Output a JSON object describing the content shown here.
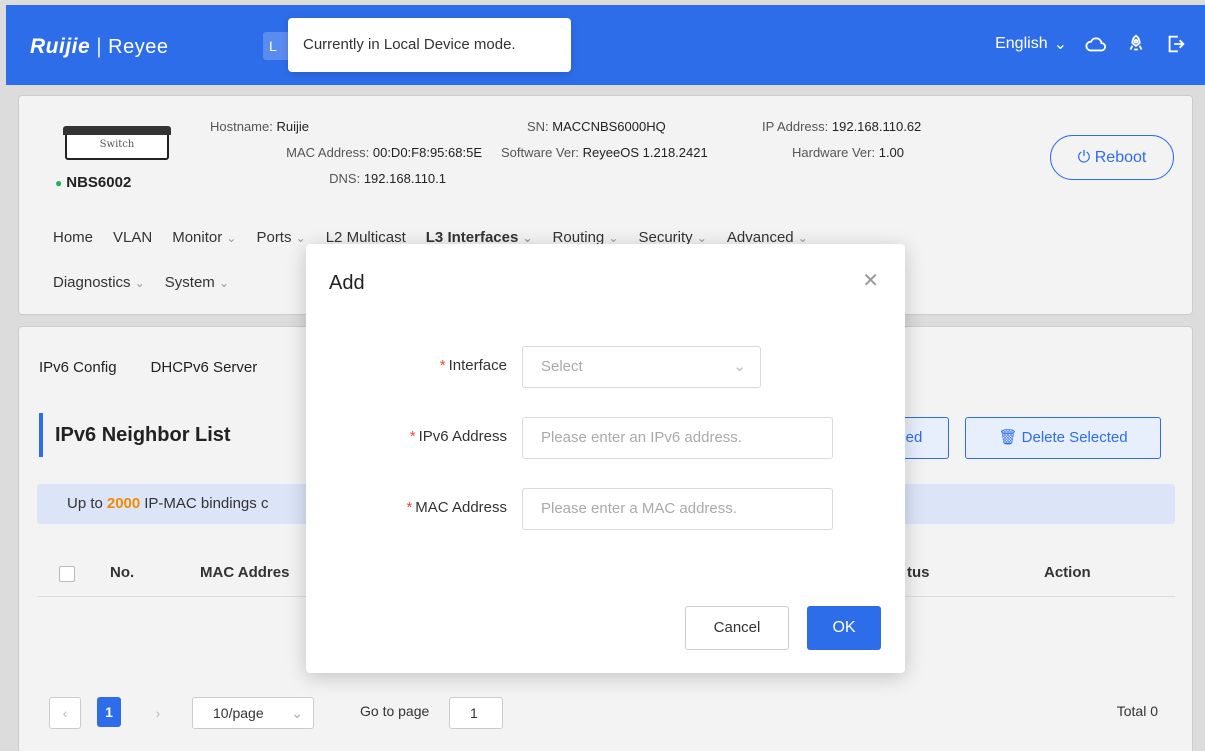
{
  "brand": {
    "logo": "Ruijie",
    "logo2": "Reyee",
    "mode_button_stub": "L"
  },
  "tooltip": "Currently in Local Device mode.",
  "topbar": {
    "language": "English"
  },
  "device": {
    "image_label": "Switch",
    "model": "NBS6002",
    "hostname_label": "Hostname:",
    "hostname": "Ruijie",
    "mac_label": "MAC Address:",
    "mac": "00:D0:F8:95:68:5E",
    "dns_label": "DNS:",
    "dns": "192.168.110.1",
    "sn_label": "SN:",
    "sn": "MACCNBS6000HQ",
    "software_label": "Software Ver:",
    "software": "ReyeeOS 1.218.2421",
    "ip_label": "IP Address:",
    "ip": "192.168.110.62",
    "hardware_label": "Hardware Ver:",
    "hardware": "1.00",
    "reboot_label": "Reboot"
  },
  "menu": {
    "row1": [
      "Home",
      "VLAN",
      "Monitor",
      "Ports",
      "L2 Multicast",
      "L3 Interfaces",
      "Routing",
      "Security",
      "Advanced"
    ],
    "row2": [
      "Diagnostics",
      "System"
    ]
  },
  "content": {
    "tabs": [
      "IPv6 Config",
      "DHCPv6 Server"
    ],
    "section_title": "IPv6 Neighbor List",
    "bind_selected_stub": "ed",
    "delete_selected": "Delete Selected",
    "notice_prefix": "Up to",
    "notice_count": "2000",
    "notice_suffix": "IP-MAC bindings c",
    "columns": {
      "no": "No.",
      "mac": "MAC Addres",
      "status": "tus",
      "action": "Action"
    },
    "pager": {
      "current": "1",
      "page_size": "10/page",
      "goto_label": "Go to page",
      "goto_value": "1",
      "total": "Total 0"
    }
  },
  "dialog": {
    "title": "Add",
    "interface_label": "Interface",
    "interface_placeholder": "Select",
    "ipv6_label": "IPv6 Address",
    "ipv6_placeholder": "Please enter an IPv6 address.",
    "mac_label": "MAC Address",
    "mac_placeholder": "Please enter a MAC address.",
    "cancel": "Cancel",
    "ok": "OK"
  },
  "colors": {
    "primary": "#2e6dea",
    "accent_orange": "#f08c00",
    "required": "#e74c3c",
    "online": "#27ae60"
  }
}
